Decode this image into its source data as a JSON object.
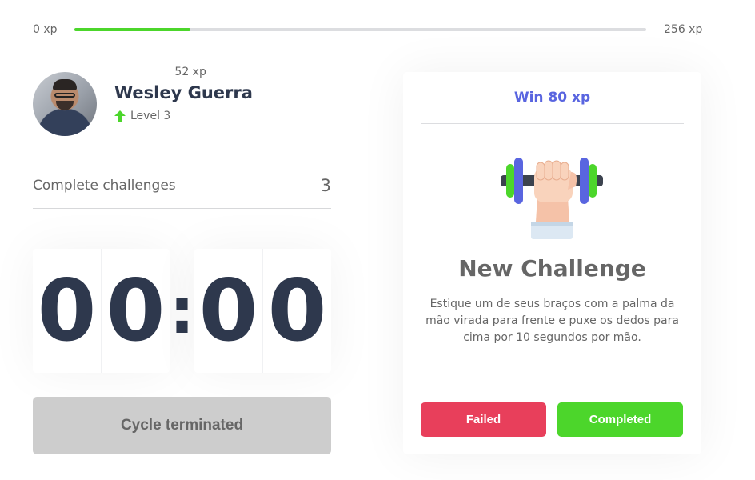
{
  "xp": {
    "min_label": "0 xp",
    "max_label": "256 xp",
    "current_label": "52 xp",
    "progress_fraction": 0.203,
    "fill_color": "#4cd62b"
  },
  "profile": {
    "name": "Wesley Guerra",
    "level_label": "Level 3",
    "level_icon": "level-up-arrow-icon"
  },
  "challenges": {
    "label": "Complete challenges",
    "count": "3"
  },
  "countdown": {
    "minute_left": "0",
    "minute_right": "0",
    "separator": ":",
    "second_left": "0",
    "second_right": "0"
  },
  "cycle_button": {
    "label": "Cycle terminated"
  },
  "challenge_card": {
    "reward": "Win 80 xp",
    "icon": "dumbbell-hand-icon",
    "title": "New Challenge",
    "description": "Estique um de seus braços com a palma da mão virada para frente e puxe os dedos para cima por 10 segundos por mão.",
    "failed_label": "Failed",
    "completed_label": "Completed"
  },
  "colors": {
    "accent": "#5965e0",
    "success": "#4cd62b",
    "danger": "#e83f5b",
    "title": "#2e384d",
    "text": "#666666"
  }
}
